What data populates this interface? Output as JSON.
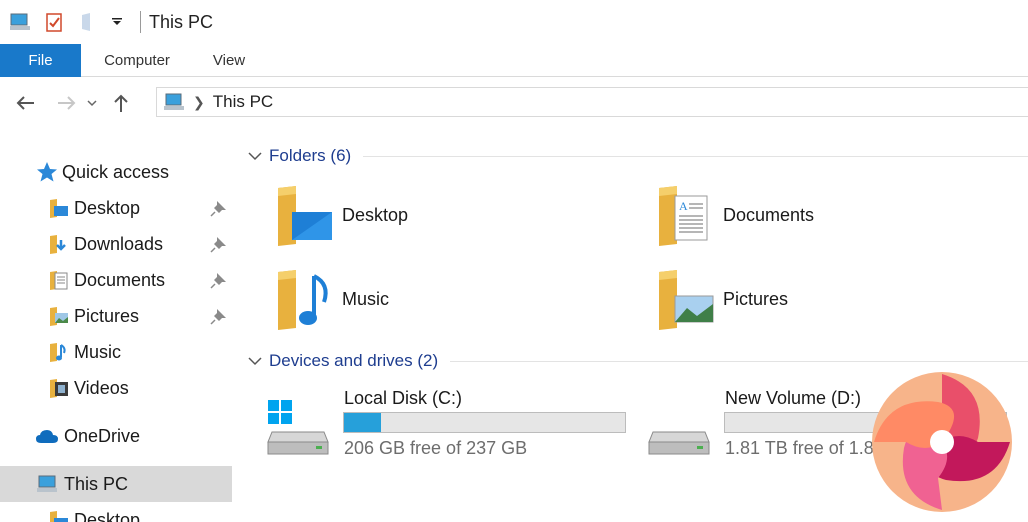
{
  "window": {
    "title": "This PC"
  },
  "ribbon": {
    "tabs": [
      {
        "label": "File"
      },
      {
        "label": "Computer"
      },
      {
        "label": "View"
      }
    ]
  },
  "address": {
    "crumbs": [
      "This PC"
    ]
  },
  "sidebar": {
    "items": [
      {
        "label": "Quick access",
        "icon": "star-icon",
        "pinned": false
      },
      {
        "label": "Desktop",
        "icon": "desktop-folder-icon",
        "pinned": true
      },
      {
        "label": "Downloads",
        "icon": "downloads-folder-icon",
        "pinned": true
      },
      {
        "label": "Documents",
        "icon": "documents-folder-icon",
        "pinned": true
      },
      {
        "label": "Pictures",
        "icon": "pictures-folder-icon",
        "pinned": true
      },
      {
        "label": "Music",
        "icon": "music-folder-icon",
        "pinned": false
      },
      {
        "label": "Videos",
        "icon": "videos-folder-icon",
        "pinned": false
      },
      {
        "label": "OneDrive",
        "icon": "cloud-icon",
        "pinned": false
      },
      {
        "label": "This PC",
        "icon": "computer-icon",
        "selected": true
      },
      {
        "label": "Desktop",
        "icon": "desktop-folder-icon",
        "pinned": false
      }
    ]
  },
  "main": {
    "folders_group": {
      "title": "Folders (6)"
    },
    "folders": [
      {
        "label": "Desktop",
        "icon": "desktop-folder-icon"
      },
      {
        "label": "Documents",
        "icon": "documents-folder-icon"
      },
      {
        "label": "Music",
        "icon": "music-folder-icon"
      },
      {
        "label": "Pictures",
        "icon": "pictures-folder-icon"
      }
    ],
    "drives_group": {
      "title": "Devices and drives (2)"
    },
    "drives": [
      {
        "name": "Local Disk (C:)",
        "free_text": "206 GB free of 237 GB",
        "used_fraction": 0.13,
        "icon": "windows-drive-icon"
      },
      {
        "name": "New Volume (D:)",
        "free_text": "1.81 TB free of 1.81 TB",
        "used_fraction": 0.0,
        "icon": "drive-icon"
      }
    ]
  },
  "colors": {
    "accent": "#1979ca",
    "bar_fill": "#26a0da",
    "group_title": "#1e3d8f",
    "folder": "#f5c451"
  }
}
